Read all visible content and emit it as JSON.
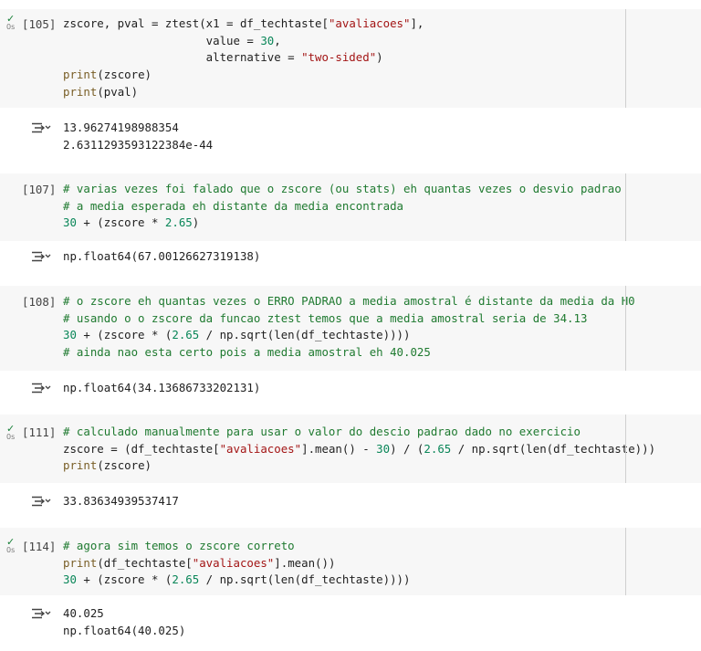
{
  "cells": [
    {
      "prompt": "[105]",
      "status": "0s",
      "code": [
        [
          [
            "t",
            "zscore, pval = ztest(x1 = df_techtaste["
          ],
          [
            "s",
            "\"avaliacoes\""
          ],
          [
            "t",
            "],"
          ]
        ],
        [
          [
            "t",
            "                     value = "
          ],
          [
            "n",
            "30"
          ],
          [
            "t",
            ","
          ]
        ],
        [
          [
            "t",
            "                     alternative = "
          ],
          [
            "s",
            "\"two-sided\""
          ],
          [
            "t",
            ")"
          ]
        ],
        [
          [
            "f",
            "print"
          ],
          [
            "t",
            "(zscore)"
          ]
        ],
        [
          [
            "f",
            "print"
          ],
          [
            "t",
            "(pval)"
          ]
        ]
      ],
      "output": [
        "13.96274198988354",
        "2.6311293593122384e-44"
      ]
    },
    {
      "prompt": "[107]",
      "status": "",
      "code": [
        [
          [
            "c",
            "# varias vezes foi falado que o zscore (ou stats) eh quantas vezes o desvio padrao"
          ]
        ],
        [
          [
            "c",
            "# a media esperada eh distante da media encontrada"
          ]
        ],
        [
          [
            "n",
            "30"
          ],
          [
            "t",
            " + (zscore * "
          ],
          [
            "n",
            "2.65"
          ],
          [
            "t",
            ")"
          ]
        ]
      ],
      "output": [
        "np.float64(67.00126627319138)"
      ]
    },
    {
      "prompt": "[108]",
      "status": "",
      "code": [
        [
          [
            "c",
            "# o zscore eh quantas vezes o ERRO PADRAO a media amostral é distante da media da H0"
          ]
        ],
        [
          [
            "c",
            "# usando o o zscore da funcao ztest temos que a media amostral seria de 34.13"
          ]
        ],
        [
          [
            "n",
            "30"
          ],
          [
            "t",
            " + (zscore * ("
          ],
          [
            "n",
            "2.65"
          ],
          [
            "t",
            " / np.sqrt(len(df_techtaste))))"
          ]
        ],
        [
          [
            "c",
            "# ainda nao esta certo pois a media amostral eh 40.025"
          ]
        ]
      ],
      "output": [
        "np.float64(34.13686733202131)"
      ]
    },
    {
      "prompt": "[111]",
      "status": "0s",
      "code": [
        [
          [
            "c",
            "# calculado manualmente para usar o valor do descio padrao dado no exercicio"
          ]
        ],
        [
          [
            "t",
            "zscore = (df_techtaste["
          ],
          [
            "s",
            "\"avaliacoes\""
          ],
          [
            "t",
            "].mean() - "
          ],
          [
            "n",
            "30"
          ],
          [
            "t",
            ") / ("
          ],
          [
            "n",
            "2.65"
          ],
          [
            "t",
            " / np.sqrt(len(df_techtaste)))"
          ]
        ],
        [
          [
            "f",
            "print"
          ],
          [
            "t",
            "(zscore)"
          ]
        ]
      ],
      "output": [
        "33.83634939537417"
      ]
    },
    {
      "prompt": "[114]",
      "status": "0s",
      "code": [
        [
          [
            "c",
            "# agora sim temos o zscore correto"
          ]
        ],
        [
          [
            "f",
            "print"
          ],
          [
            "t",
            "(df_techtaste["
          ],
          [
            "s",
            "\"avaliacoes\""
          ],
          [
            "t",
            "].mean())"
          ]
        ],
        [
          [
            "n",
            "30"
          ],
          [
            "t",
            " + (zscore * ("
          ],
          [
            "n",
            "2.65"
          ],
          [
            "t",
            " / np.sqrt(len(df_techtaste))))"
          ]
        ]
      ],
      "output": [
        "40.025",
        "np.float64(40.025)"
      ]
    }
  ],
  "icons": {
    "run_status": "check-icon",
    "output_toggle": "output-arrow-icon"
  }
}
